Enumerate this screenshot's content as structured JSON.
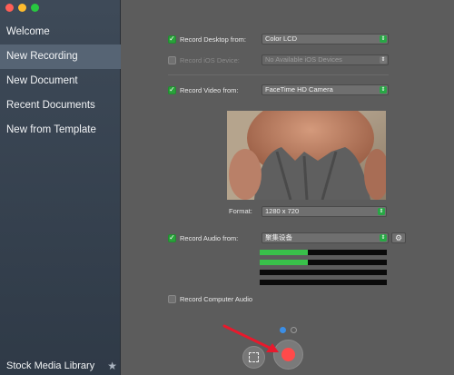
{
  "sidebar": {
    "items": [
      {
        "label": "Welcome",
        "active": false
      },
      {
        "label": "New Recording",
        "active": true
      },
      {
        "label": "New Document",
        "active": false
      },
      {
        "label": "Recent Documents",
        "active": false
      },
      {
        "label": "New from Template",
        "active": false
      }
    ],
    "footer": {
      "label": "Stock Media Library",
      "icon": "star-icon"
    }
  },
  "recording": {
    "desktop": {
      "checked": true,
      "label": "Record Desktop from:",
      "value": "Color LCD"
    },
    "ios": {
      "checked": false,
      "label": "Record iOS Device:",
      "value": "No Available iOS Devices"
    },
    "video": {
      "checked": true,
      "label": "Record Video from:",
      "value": "FaceTime HD Camera"
    },
    "format": {
      "label": "Format:",
      "value": "1280 x 720"
    },
    "audio": {
      "checked": true,
      "label": "Record Audio from:",
      "value": "聚集设备",
      "levels": [
        0.38,
        0.38,
        0,
        0,
        0
      ]
    },
    "computer_audio": {
      "checked": false,
      "label": "Record Computer Audio"
    }
  },
  "pager": {
    "pages": 2,
    "current": 1
  },
  "colors": {
    "accent": "#29a23a",
    "record": "#ff4a4a",
    "page_dot": "#3b8ee6"
  }
}
